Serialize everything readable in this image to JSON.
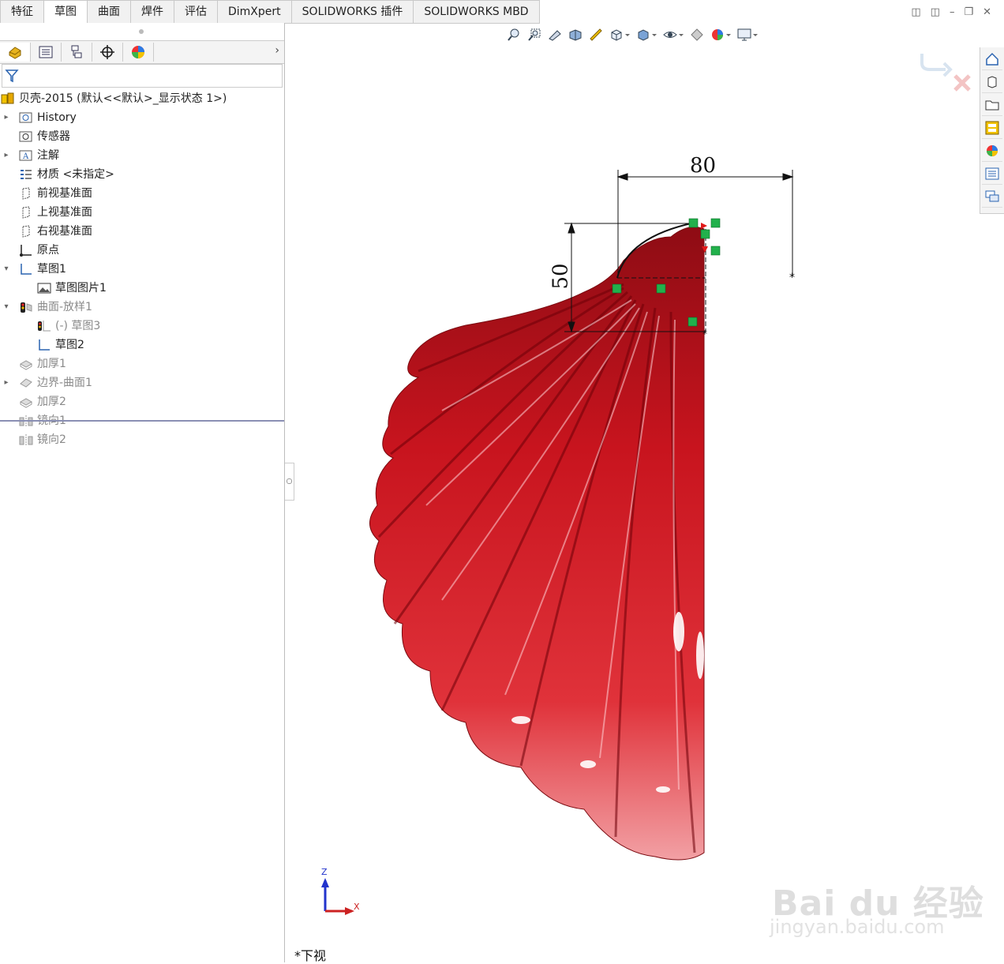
{
  "tabs": [
    {
      "label": "特征"
    },
    {
      "label": "草图"
    },
    {
      "label": "曲面"
    },
    {
      "label": "焊件"
    },
    {
      "label": "评估"
    },
    {
      "label": "DimXpert"
    },
    {
      "label": "SOLIDWORKS 插件"
    },
    {
      "label": "SOLIDWORKS MBD"
    }
  ],
  "active_tab": 1,
  "tree": {
    "root": "贝壳-2015  (默认<<默认>_显示状态 1>)",
    "items": [
      {
        "label": "History"
      },
      {
        "label": "传感器"
      },
      {
        "label": "注解"
      },
      {
        "label": "材质 <未指定>"
      },
      {
        "label": "前视基准面"
      },
      {
        "label": "上视基准面"
      },
      {
        "label": "右视基准面"
      },
      {
        "label": "原点"
      },
      {
        "label": "草图1"
      },
      {
        "label": "草图图片1"
      },
      {
        "label": "曲面-放样1"
      },
      {
        "label": "(-) 草图3"
      },
      {
        "label": "草图2"
      },
      {
        "label": "加厚1"
      },
      {
        "label": "边界-曲面1"
      },
      {
        "label": "加厚2"
      },
      {
        "label": "镜向1"
      },
      {
        "label": "镜向2"
      }
    ]
  },
  "viewport": {
    "dim_horizontal": "80",
    "dim_vertical": "50",
    "view_name": "*下视",
    "triad_z": "Z",
    "triad_x": "X"
  },
  "watermark": {
    "line1": "Bai du 经验",
    "line2": "jingyan.baidu.com"
  },
  "colors": {
    "shell_red": "#c8141e",
    "relation_green": "#22b14c",
    "tab_border": "#c9c9c9"
  }
}
